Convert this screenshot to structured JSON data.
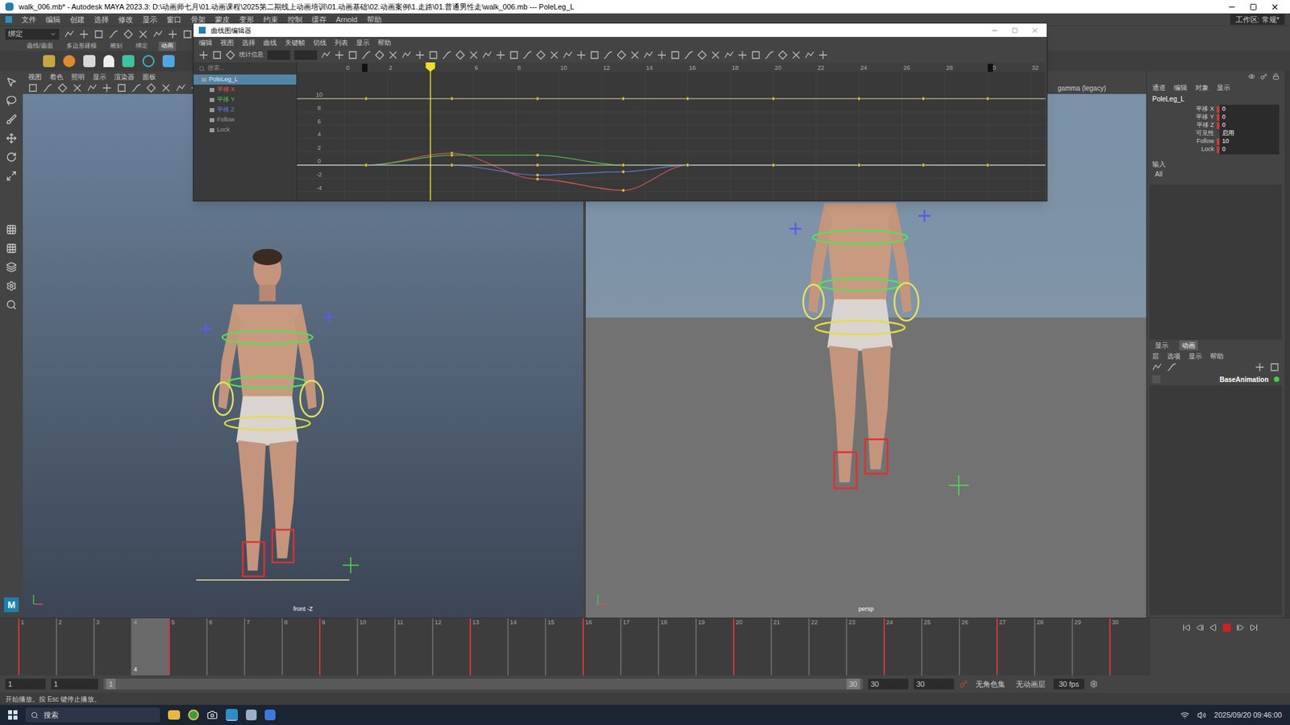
{
  "window": {
    "title": "walk_006.mb* - Autodesk MAYA 2023.3: D:\\动画师七月\\01.动画课程\\2025第二期线上动画培训\\01.动画基础\\02.动画案例\\1.走路\\01.普通男性走\\walk_006.mb  ---  PoleLeg_L"
  },
  "menubar": {
    "items": [
      "文件",
      "编辑",
      "创建",
      "选择",
      "修改",
      "显示",
      "窗口",
      "骨架",
      "蒙皮",
      "变形",
      "约束",
      "控制",
      "缓存",
      "Arnold",
      "帮助"
    ],
    "workspace": "工作区: 常规*"
  },
  "status_line": {
    "mode": "绑定"
  },
  "shelf": {
    "tabs": [
      {
        "label": "曲线/曲面",
        "selected": false
      },
      {
        "label": "多边形建模",
        "selected": false
      },
      {
        "label": "雕刻",
        "selected": false
      },
      {
        "label": "绑定",
        "selected": false
      },
      {
        "label": "动画",
        "selected": true
      }
    ]
  },
  "viewport_left": {
    "menu": [
      "视图",
      "着色",
      "照明",
      "显示",
      "渲染器",
      "面板"
    ],
    "label": "front -Z"
  },
  "viewport_right": {
    "color_space": "gamma (legacy)",
    "label": "persp"
  },
  "graph_editor": {
    "title": "曲线图编辑器",
    "menu": [
      "编辑",
      "视图",
      "选择",
      "曲线",
      "关键帧",
      "切线",
      "列表",
      "显示",
      "帮助"
    ],
    "stats_label": "统计信息",
    "search_placeholder": "搜索...",
    "outliner": [
      {
        "label": "PoleLeg_L",
        "selected": true,
        "color": "#e8e8e8"
      },
      {
        "label": "平移 X",
        "selected": false,
        "color": "#e0534f"
      },
      {
        "label": "平移 Y",
        "selected": false,
        "color": "#4fbf4f"
      },
      {
        "label": "平移 Z",
        "selected": false,
        "color": "#5a7ee0"
      },
      {
        "label": "Follow",
        "selected": false,
        "color": "#9a9a9a"
      },
      {
        "label": "Lock",
        "selected": false,
        "color": "#9a9a9a"
      }
    ],
    "time_ticks": [
      "0",
      "2",
      "4",
      "6",
      "8",
      "10",
      "12",
      "14",
      "16",
      "18",
      "20",
      "22",
      "24",
      "26",
      "28",
      "30",
      "32"
    ],
    "value_ticks": [
      "10",
      "8",
      "6",
      "4",
      "2",
      "0",
      "-2",
      "-4"
    ],
    "current_frame": "4",
    "series": [
      {
        "name": "平移 X",
        "color": "#e0534f",
        "frames": [
          1,
          5,
          9,
          13,
          16,
          20,
          24,
          27,
          30
        ],
        "values": [
          0,
          1.8,
          -2.1,
          -3.8,
          0,
          0,
          0,
          0,
          0
        ]
      },
      {
        "name": "平移 Y",
        "color": "#4fbf4f",
        "frames": [
          1,
          5,
          9,
          13,
          16,
          20,
          24,
          27,
          30
        ],
        "values": [
          0,
          1.5,
          1.5,
          0,
          0,
          0,
          0,
          0,
          0
        ]
      },
      {
        "name": "平移 Z",
        "color": "#5a7ee0",
        "frames": [
          1,
          5,
          9,
          13,
          16,
          20,
          24,
          27,
          30
        ],
        "values": [
          0,
          0,
          -1.5,
          -1,
          0,
          0,
          0,
          0,
          0
        ]
      },
      {
        "name": "Follow",
        "color": "#d8d4b8",
        "frames": [
          1,
          5,
          9,
          13,
          16,
          20,
          24,
          27,
          30
        ],
        "values": [
          10,
          10,
          10,
          10,
          10,
          10,
          10,
          10,
          10
        ]
      },
      {
        "name": "Lock",
        "color": "#d8d4b8",
        "frames": [
          1,
          5,
          9,
          13,
          16,
          20,
          24,
          27,
          30
        ],
        "values": [
          0,
          0,
          0,
          0,
          0,
          0,
          0,
          0,
          0
        ]
      }
    ]
  },
  "channel_box": {
    "tabs": [
      "通道",
      "编辑",
      "对象",
      "显示"
    ],
    "node": "PoleLeg_L",
    "attributes": [
      {
        "label": "平移 X",
        "value": "0",
        "keyed": true
      },
      {
        "label": "平移 Y",
        "value": "0",
        "keyed": true
      },
      {
        "label": "平移 Z",
        "value": "0",
        "keyed": true
      },
      {
        "label": "可见性",
        "value": "启用",
        "keyed": false
      },
      {
        "label": "Follow",
        "value": "10",
        "keyed": true
      },
      {
        "label": "Lock",
        "value": "0",
        "keyed": true
      }
    ],
    "inputs_label": "输入",
    "inputs_value": "All"
  },
  "layer_editor": {
    "tabs": [
      {
        "label": "显示",
        "selected": false
      },
      {
        "label": "动画",
        "selected": true
      }
    ],
    "menu": [
      "层",
      "选项",
      "显示",
      "帮助"
    ],
    "layers": [
      {
        "name": "BaseAnimation",
        "active": true,
        "color": "#3fd03f"
      }
    ]
  },
  "timeline": {
    "frames": [
      "1",
      "2",
      "3",
      "4",
      "5",
      "6",
      "7",
      "8",
      "9",
      "10",
      "11",
      "12",
      "13",
      "14",
      "15",
      "16",
      "17",
      "18",
      "19",
      "20",
      "21",
      "22",
      "23",
      "24",
      "25",
      "26",
      "27",
      "28",
      "29",
      "30"
    ],
    "keys": [
      1,
      5,
      9,
      13,
      16,
      20,
      24,
      27,
      30
    ],
    "current": "4",
    "playing": true
  },
  "range": {
    "start": "1",
    "inner_start": "1",
    "slider_start": "1",
    "slider_end": "30",
    "inner_end": "30",
    "end": "30",
    "character_set": "无角色集",
    "anim_layer": "无动画层",
    "fps": "30 fps"
  },
  "help_line": "开始播放。按 Esc 键停止播放。",
  "logo": "M",
  "taskbar": {
    "search": "搜索",
    "clock": "2025/09/20 09:46:00"
  }
}
